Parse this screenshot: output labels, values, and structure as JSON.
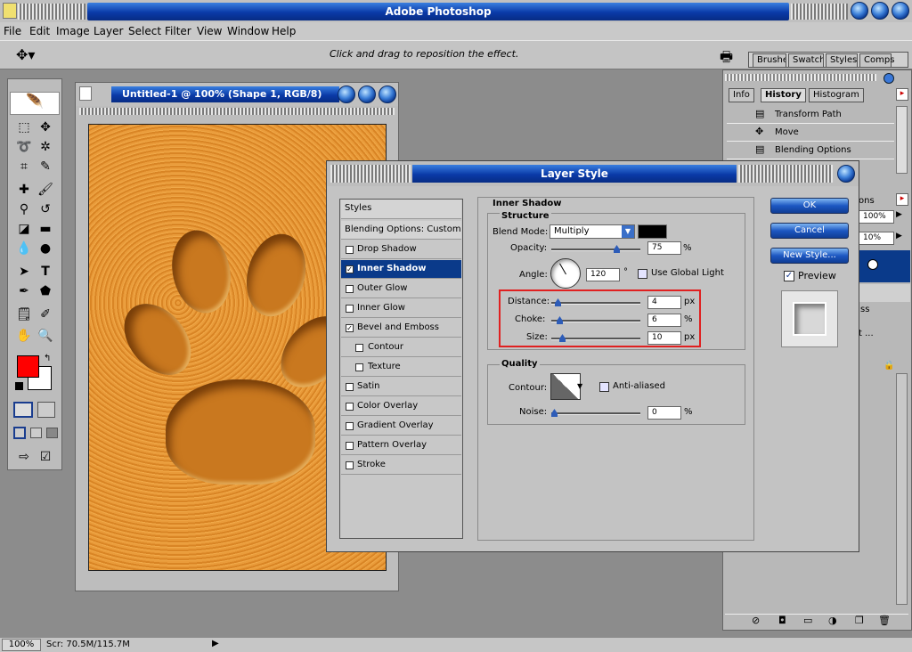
{
  "app": {
    "title": "Adobe Photoshop"
  },
  "menu": [
    "File",
    "Edit",
    "Image",
    "Layer",
    "Select",
    "Filter",
    "View",
    "Window",
    "Help"
  ],
  "options": {
    "hint": "Click and drag to reposition the effect.",
    "tabs": [
      "Brushes",
      "Swatches",
      "Styles",
      "Comps"
    ]
  },
  "document": {
    "title": "Untitled-1 @ 100% (Shape 1, RGB/8)"
  },
  "history": {
    "tabs": [
      "Info",
      "History",
      "Histogram"
    ],
    "items": [
      "Transform Path",
      "Move",
      "Blending Options"
    ]
  },
  "right_panel_fragments": {
    "tab_fragment": "ons",
    "percent1": "100%",
    "percent2": "10%",
    "text1": "ss",
    "text2": "t ..."
  },
  "dialog": {
    "title": "Layer Style",
    "styles_header": "Styles",
    "blending": "Blending Options: Custom",
    "effects": [
      {
        "label": "Drop Shadow",
        "checked": false,
        "selected": false,
        "indent": false
      },
      {
        "label": "Inner Shadow",
        "checked": true,
        "selected": true,
        "indent": false
      },
      {
        "label": "Outer Glow",
        "checked": false,
        "selected": false,
        "indent": false
      },
      {
        "label": "Inner Glow",
        "checked": false,
        "selected": false,
        "indent": false
      },
      {
        "label": "Bevel and Emboss",
        "checked": true,
        "selected": false,
        "indent": false
      },
      {
        "label": "Contour",
        "checked": false,
        "selected": false,
        "indent": true
      },
      {
        "label": "Texture",
        "checked": false,
        "selected": false,
        "indent": true
      },
      {
        "label": "Satin",
        "checked": false,
        "selected": false,
        "indent": false
      },
      {
        "label": "Color Overlay",
        "checked": false,
        "selected": false,
        "indent": false
      },
      {
        "label": "Gradient Overlay",
        "checked": false,
        "selected": false,
        "indent": false
      },
      {
        "label": "Pattern Overlay",
        "checked": false,
        "selected": false,
        "indent": false
      },
      {
        "label": "Stroke",
        "checked": false,
        "selected": false,
        "indent": false
      }
    ],
    "section_title": "Inner Shadow",
    "structure": "Structure",
    "blend_mode_label": "Blend Mode:",
    "blend_mode_value": "Multiply",
    "opacity_label": "Opacity:",
    "opacity_value": "75",
    "opacity_unit": "%",
    "angle_label": "Angle:",
    "angle_value": "120",
    "angle_unit": "°",
    "global_light": "Use Global Light",
    "distance_label": "Distance:",
    "distance_value": "4",
    "distance_unit": "px",
    "choke_label": "Choke:",
    "choke_value": "6",
    "choke_unit": "%",
    "size_label": "Size:",
    "size_value": "10",
    "size_unit": "px",
    "quality": "Quality",
    "contour_label": "Contour:",
    "anti_aliased": "Anti-aliased",
    "noise_label": "Noise:",
    "noise_value": "0",
    "noise_unit": "%",
    "ok": "OK",
    "cancel": "Cancel",
    "new_style": "New Style...",
    "preview": "Preview",
    "shadow_color": "#000000",
    "slider_levels": {
      "opacity": 0.75,
      "distance": 0.04,
      "choke": 0.06,
      "size": 0.1,
      "noise": 0.0
    }
  },
  "status": {
    "zoom": "100%",
    "scratch": "Scr: 70.5M/115.7M"
  },
  "colors": {
    "foreground": "#ff0000",
    "background": "#ffffff",
    "highlight": "#e02020",
    "accent": "#0a3a8a"
  }
}
